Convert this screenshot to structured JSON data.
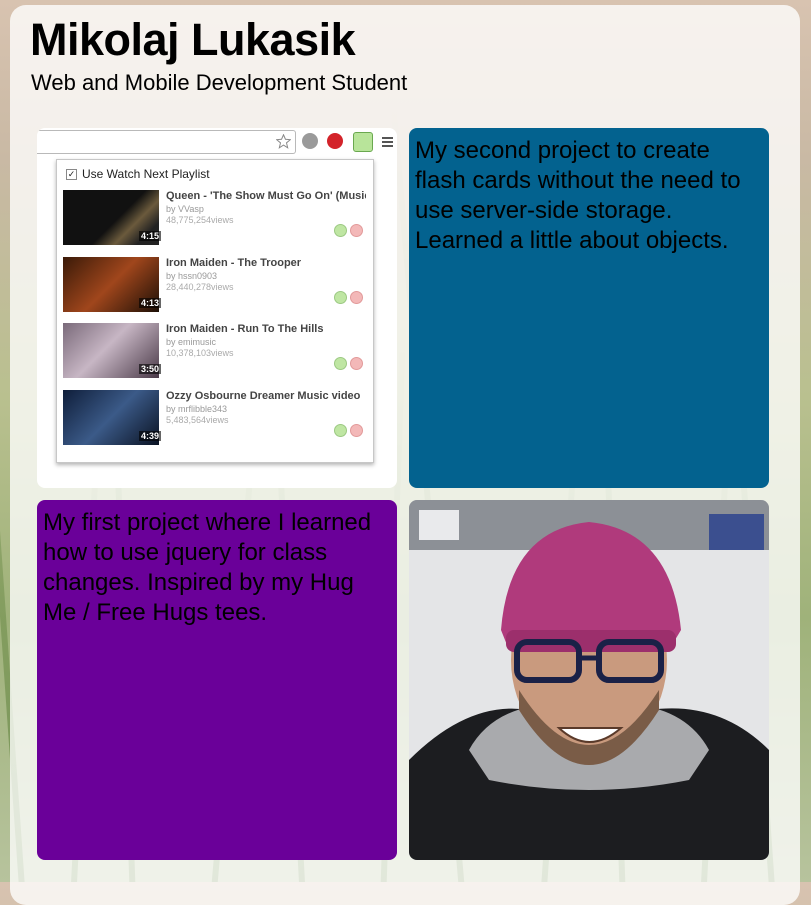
{
  "header": {
    "name": "Mikolaj Lukasik",
    "tagline": "Web and Mobile Development Student"
  },
  "projects": {
    "flash_cards": {
      "text": "My second project to create flash cards without the need to use server-side storage. Learned a little about objects.",
      "bg": "#03628f"
    },
    "hug_me": {
      "text": "My first project where I learned how to use jquery for class changes. Inspired by my Hug Me / Free Hugs tees.",
      "bg": "#6a0099"
    }
  },
  "extension": {
    "playlist_label": "Use Watch Next Playlist",
    "videos": [
      {
        "title": "Queen - 'The Show Must Go On' (Music",
        "by": "by VVasp",
        "views": "48,775,254views",
        "duration": "4:15"
      },
      {
        "title": "Iron Maiden - The Trooper",
        "by": "by hssn0903",
        "views": "28,440,278views",
        "duration": "4:13"
      },
      {
        "title": "Iron Maiden - Run To The Hills",
        "by": "by emimusic",
        "views": "10,378,103views",
        "duration": "3:50"
      },
      {
        "title": "Ozzy Osbourne Dreamer Music video",
        "by": "by mrflibble343",
        "views": "5,483,564views",
        "duration": "4:39"
      }
    ]
  },
  "icons": [
    "star-icon",
    "download-icon",
    "pinterest-icon",
    "extension-icon",
    "menu-icon",
    "add-icon",
    "remove-icon"
  ]
}
